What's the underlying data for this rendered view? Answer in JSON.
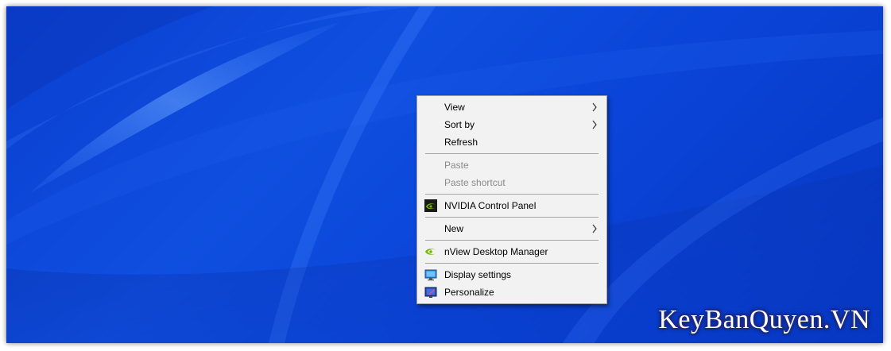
{
  "context_menu": {
    "items": [
      {
        "label": "View",
        "enabled": true,
        "submenu": true
      },
      {
        "label": "Sort by",
        "enabled": true,
        "submenu": true
      },
      {
        "label": "Refresh",
        "enabled": true,
        "submenu": false
      },
      {
        "label": "Paste",
        "enabled": false,
        "submenu": false
      },
      {
        "label": "Paste shortcut",
        "enabled": false,
        "submenu": false
      },
      {
        "label": "NVIDIA Control Panel",
        "enabled": true,
        "submenu": false,
        "icon": "nvidia-icon"
      },
      {
        "label": "New",
        "enabled": true,
        "submenu": true
      },
      {
        "label": "nView Desktop Manager",
        "enabled": true,
        "submenu": false,
        "icon": "nview-icon"
      },
      {
        "label": "Display settings",
        "enabled": true,
        "submenu": false,
        "icon": "display-settings-icon"
      },
      {
        "label": "Personalize",
        "enabled": true,
        "submenu": false,
        "icon": "personalize-icon"
      }
    ]
  },
  "watermark": {
    "text": "KeyBanQuyen.VN"
  },
  "colors": {
    "desktop_blue": "#0a44d8",
    "menu_background": "#f2f2f2",
    "disabled_text": "#8a8a8a",
    "nvidia_green": "#76b900"
  }
}
